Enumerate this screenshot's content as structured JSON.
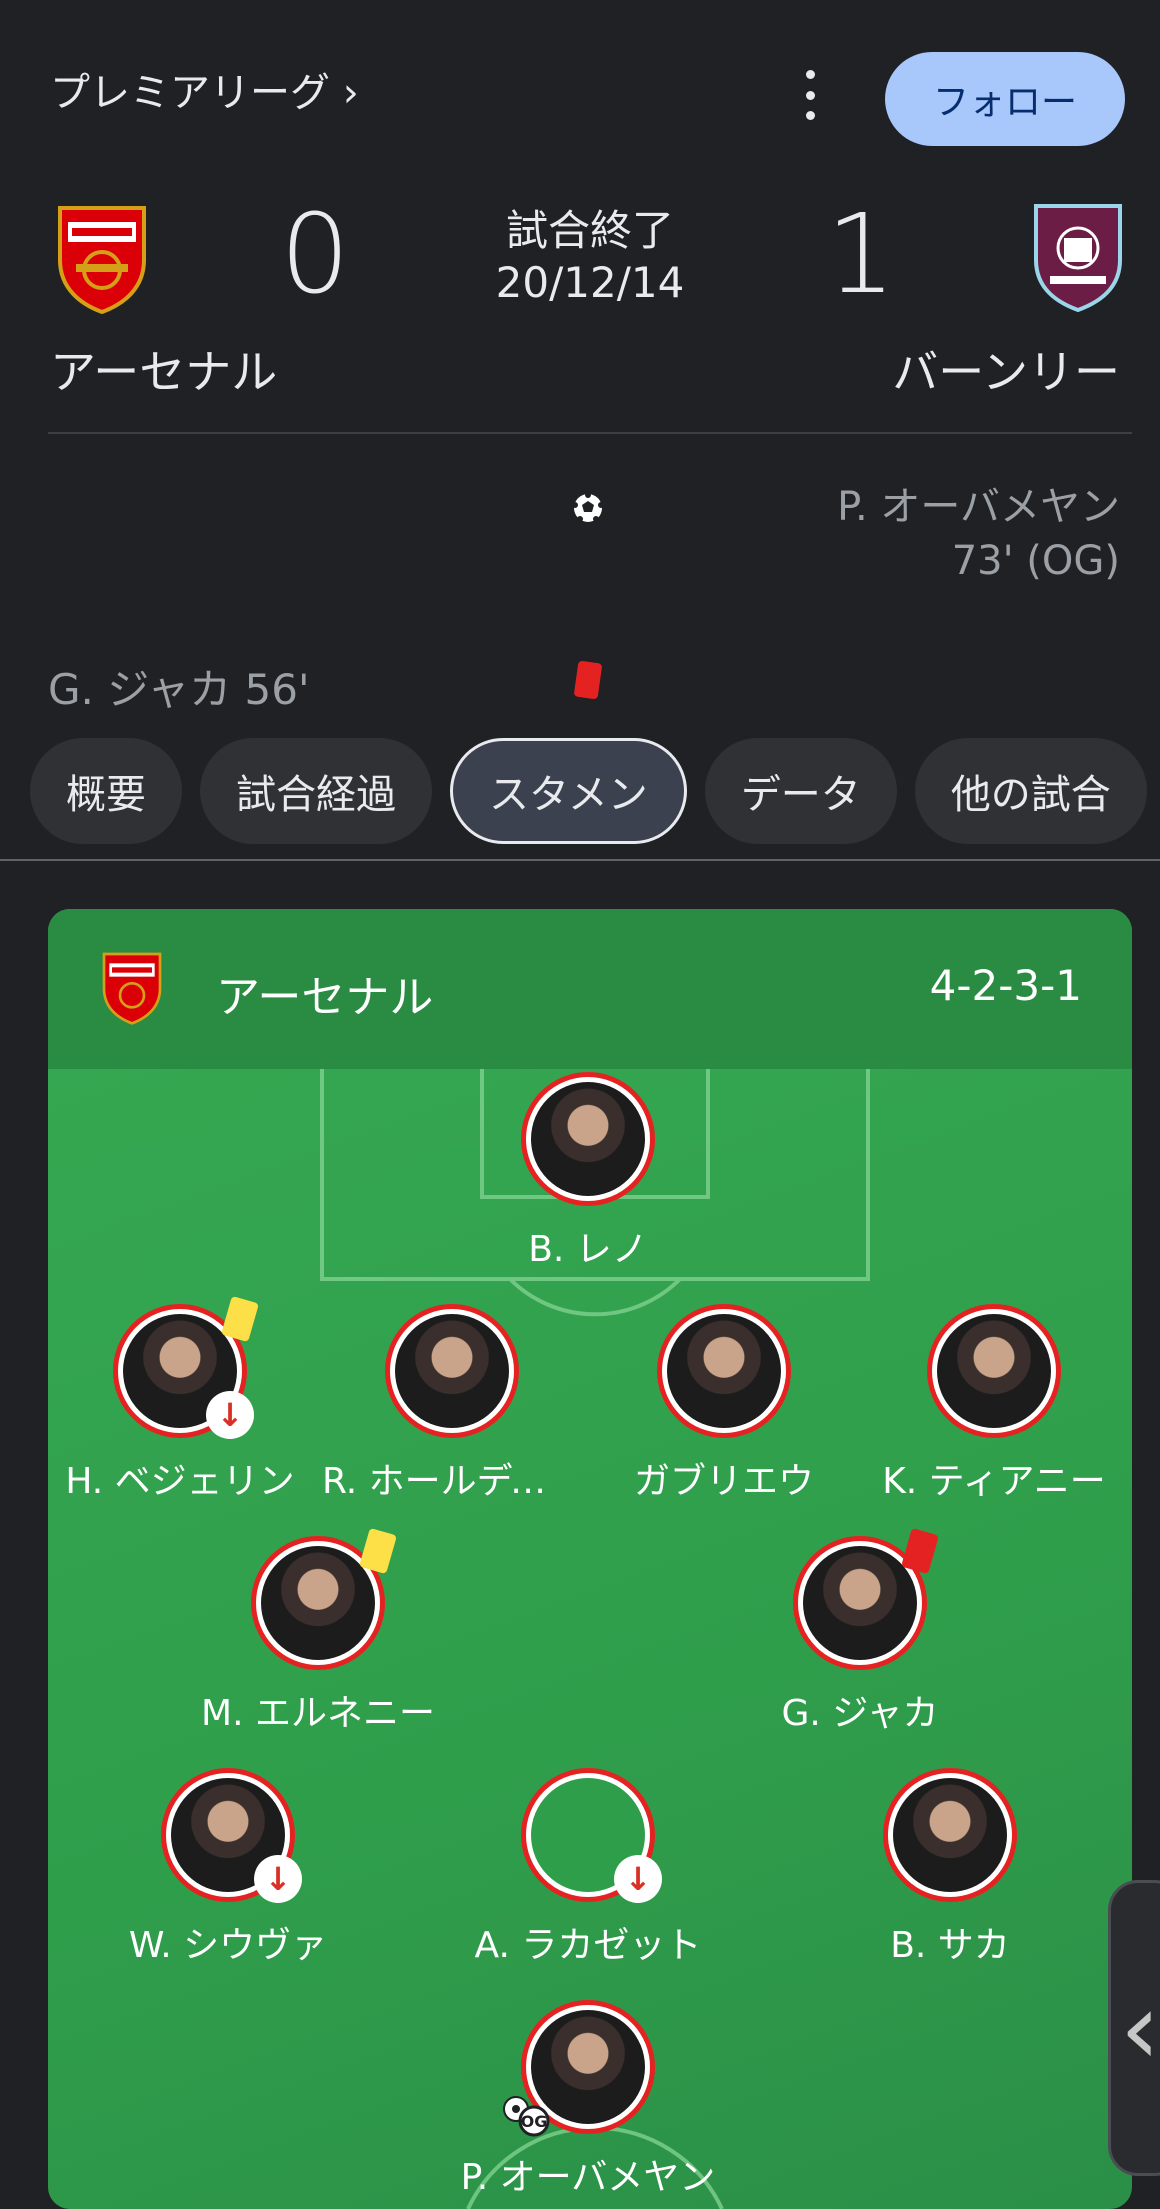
{
  "header": {
    "league": "プレミアリーグ ›",
    "follow_label": "フォロー"
  },
  "match": {
    "status": "試合終了",
    "date": "20/12/14",
    "home": {
      "name": "アーセナル",
      "score": "0"
    },
    "away": {
      "name": "バーンリー",
      "score": "1"
    }
  },
  "events": {
    "away_goal": "P. オーバメヤン 73' (OG)",
    "home_card": "G. ジャカ 56'"
  },
  "tabs": [
    "概要",
    "試合経過",
    "スタメン",
    "データ",
    "他の試合"
  ],
  "active_tab": "スタメン",
  "lineup": {
    "team": "アーセナル",
    "formation": "4-2-3-1",
    "players": {
      "gk": "B. レノ",
      "rb": "H. ベジェリン",
      "cb1": "R. ホールディ…",
      "cb2": "ガブリエウ",
      "lb": "K. ティアニー",
      "dm1": "M. エルネニー",
      "dm2": "G. ジャカ",
      "rw": "W. シウヴァ",
      "am": "A. ラカゼット",
      "lw": "B. サカ",
      "st": "P. オーバメヤン"
    }
  },
  "colors": {
    "background": "#202124",
    "follow_button": "#a8c7fa",
    "pitch": "#34a853",
    "card_red": "#e52222",
    "card_yellow": "#fde047"
  }
}
